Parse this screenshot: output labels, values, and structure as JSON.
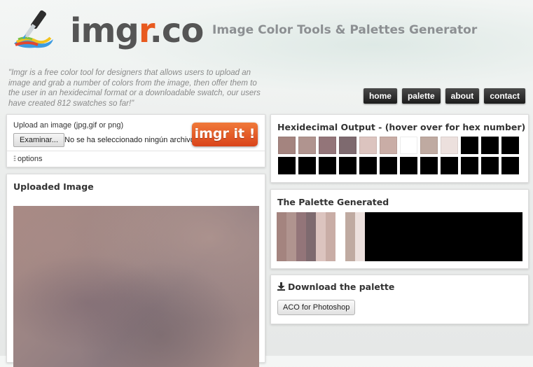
{
  "header": {
    "logo_text_prefix": "img",
    "logo_text_accent": "r",
    "logo_text_suffix": ".co",
    "tagline": "Image Color Tools & Palettes Generator",
    "description": "\"Imgr is a free color tool for designers that allows users to upload an image and grab a number of colors from the image, then offer them to the user in an hexidecimal format or a downloadable swatch, our users have created 812 swatches so far!\""
  },
  "nav": [
    {
      "label": "home"
    },
    {
      "label": "palette"
    },
    {
      "label": "about"
    },
    {
      "label": "contact"
    }
  ],
  "upload": {
    "label": "Upload an image (jpg,gif or png)",
    "file_button": "Examinar...",
    "file_status": "No se ha seleccionado ningún archivo.",
    "submit_label": "imgr it !",
    "options_label": "options",
    "options_icon": "sliders-icon"
  },
  "uploaded": {
    "title": "Uploaded Image"
  },
  "hex_output": {
    "title": "Hexidecimal Output - (hover over for hex number)",
    "colors": [
      "#a4847f",
      "#b0948f",
      "#937579",
      "#7e6a6f",
      "#dcc4bf",
      "#c9ada6",
      "#ffffff",
      "#bfaaa1",
      "#ece0dd",
      "#000000",
      "#000000",
      "#000000",
      "#000000",
      "#000000",
      "#000000",
      "#000000",
      "#000000",
      "#000000",
      "#000000",
      "#000000",
      "#000000",
      "#000000",
      "#000000",
      "#000000"
    ]
  },
  "palette": {
    "title": "The Palette Generated",
    "segments": [
      {
        "color": "#a4847f",
        "width": 14
      },
      {
        "color": "#b0948f",
        "width": 14
      },
      {
        "color": "#937579",
        "width": 14
      },
      {
        "color": "#7e6a6f",
        "width": 14
      },
      {
        "color": "#dcc4bf",
        "width": 14
      },
      {
        "color": "#c9ada6",
        "width": 14
      },
      {
        "color": "#ffffff",
        "width": 14
      },
      {
        "color": "#bfaaa1",
        "width": 14
      },
      {
        "color": "#ece0dd",
        "width": 14
      },
      {
        "color": "#000000",
        "width": 225
      }
    ]
  },
  "download": {
    "title": "Download the palette",
    "icon": "download-icon",
    "aco_button": "ACO for Photoshop"
  }
}
